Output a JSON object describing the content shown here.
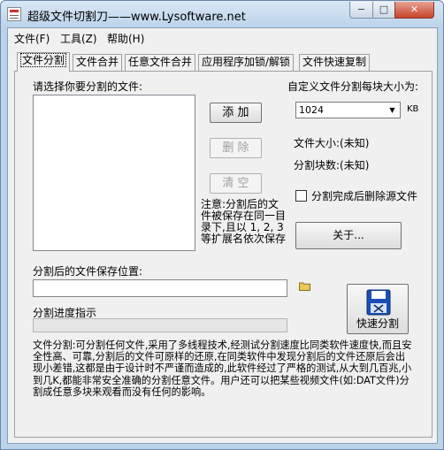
{
  "window": {
    "title": "超级文件切割刀——www.Lysoftware.net",
    "minimize_glyph": "−",
    "maximize_glyph": "□",
    "close_glyph": "✕"
  },
  "menu": {
    "file": "文件(F)",
    "tools": "工具(Z)",
    "help": "帮助(H)"
  },
  "tabs": [
    {
      "label": "文件分割",
      "active": true
    },
    {
      "label": "文件合并",
      "active": false
    },
    {
      "label": "任意文件合并",
      "active": false
    },
    {
      "label": "应用程序加锁/解锁",
      "active": false
    },
    {
      "label": "文件快速复制",
      "active": false
    }
  ],
  "split_tab": {
    "select_files_label": "请选择你要分割的文件:",
    "buttons": {
      "add": "添 加",
      "delete": "删 除",
      "clear": "清 空",
      "about": "关于...",
      "fast_split": "快速分割"
    },
    "block_size_label": "自定义文件分割每块大小为:",
    "block_size_value": "1024",
    "block_size_unit": "KB",
    "file_size_text": "文件大小:(未知)",
    "block_count_text": "分割块数:(未知)",
    "delete_source_checkbox": {
      "label": "分割完成后删除源文件",
      "checked": false
    },
    "note": "注意:分割后的文件被保存在同一目录下,且以 1, 2, 3等扩展名依次保存",
    "save_location_label": "分割后的文件保存位置:",
    "save_location_value": "",
    "progress_label": "分割进度指示",
    "progress_value": 0,
    "description": "文件分割:可分割任何文件,采用了多线程技术,经测试分割速度比同类软件速度快,而且安全性高、可靠,分割后的文件可原样的还原,在同类软件中发现分割后的文件还原后会出现小差错,这都是由于设计时不严谨而造成的,此软件经过了严格的测试,从大到几百兆,小到几K,都能非常安全准确的分割任意文件。用户还可以把某些视频文件(如:DAT文件)分割成任意多块来观看而没有任何的影响。"
  },
  "icons": [
    "app-icon",
    "folder-icon",
    "scissors-icon",
    "dropdown-arrow-icon"
  ],
  "colors": {
    "window_frame": "#bcd3ea",
    "client_bg": "#f0f0f0",
    "close_button": "#c7432b",
    "fast_split_icon": "#1a4fb8"
  }
}
